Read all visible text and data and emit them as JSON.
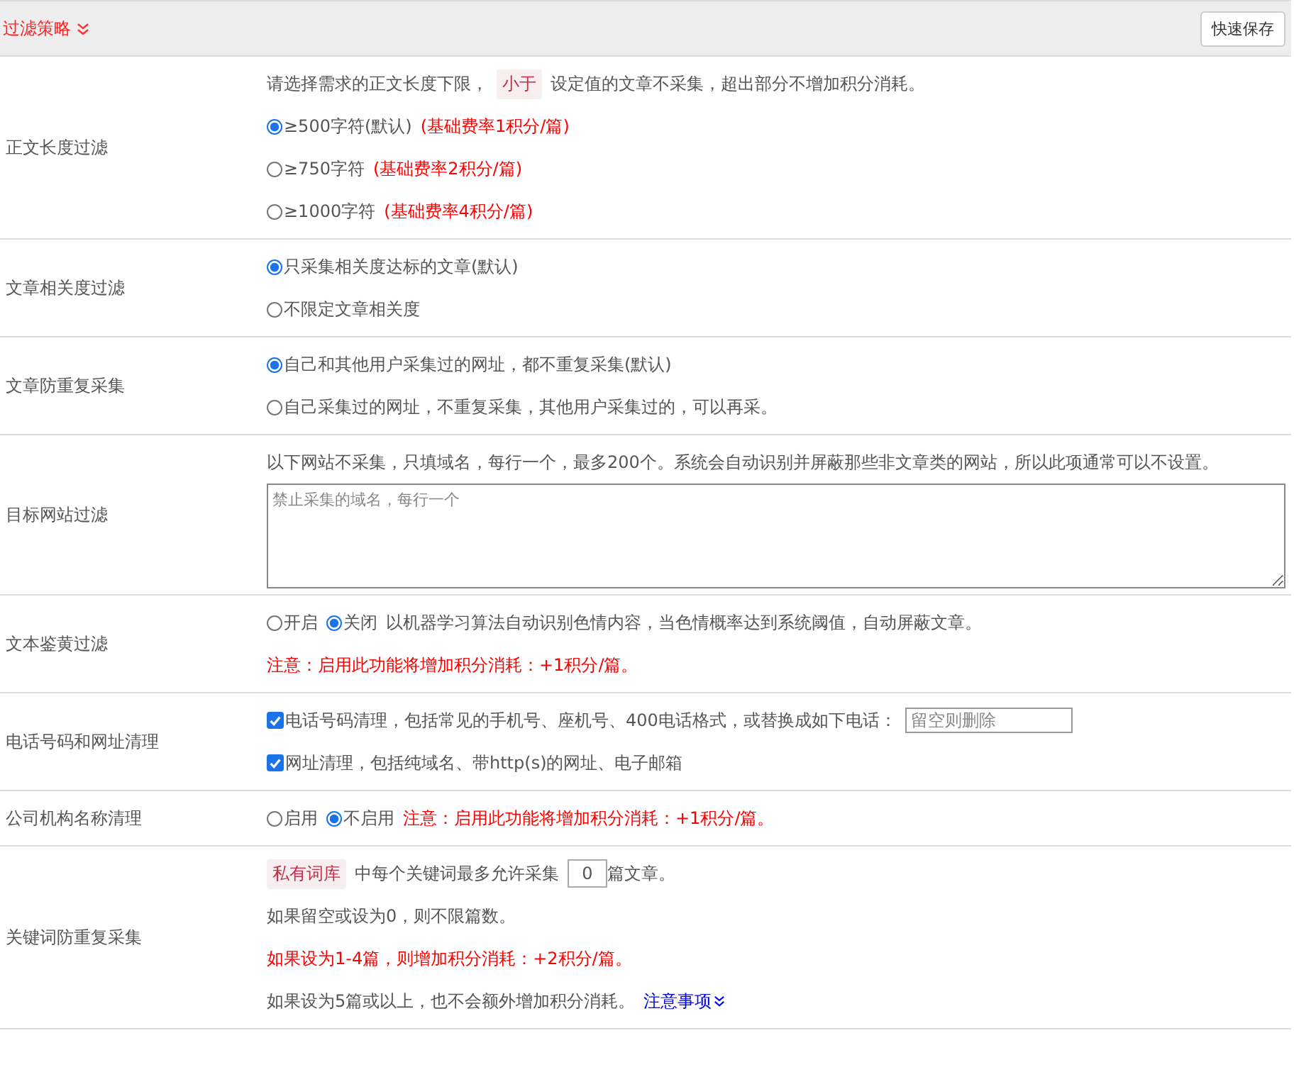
{
  "header": {
    "title": "过滤策略",
    "save_button": "快速保存"
  },
  "rows": [
    {
      "label": "正文长度过滤",
      "lines": [
        {
          "items": [
            {
              "kind": "text",
              "text": "请选择需求的正文长度下限，"
            },
            {
              "kind": "tag",
              "text": "小于"
            },
            {
              "kind": "text",
              "text": "设定值的文章不采集，超出部分不增加积分消耗。"
            }
          ]
        },
        {
          "items": [
            {
              "kind": "radio",
              "label": "≥500字符(默认)",
              "selected": true
            },
            {
              "kind": "red",
              "text": "(基础费率1积分/篇)"
            }
          ]
        },
        {
          "items": [
            {
              "kind": "radio",
              "label": "≥750字符",
              "selected": false
            },
            {
              "kind": "red",
              "text": "(基础费率2积分/篇)"
            }
          ]
        },
        {
          "items": [
            {
              "kind": "radio",
              "label": "≥1000字符",
              "selected": false
            },
            {
              "kind": "red",
              "text": "(基础费率4积分/篇)"
            }
          ]
        }
      ]
    },
    {
      "label": "文章相关度过滤",
      "lines": [
        {
          "items": [
            {
              "kind": "radio",
              "label": "只采集相关度达标的文章(默认)",
              "selected": true
            }
          ]
        },
        {
          "items": [
            {
              "kind": "radio",
              "label": "不限定文章相关度",
              "selected": false
            }
          ]
        }
      ]
    },
    {
      "label": "文章防重复采集",
      "lines": [
        {
          "items": [
            {
              "kind": "radio",
              "label": "自己和其他用户采集过的网址，都不重复采集(默认)",
              "selected": true
            }
          ]
        },
        {
          "items": [
            {
              "kind": "radio",
              "label": "自己采集过的网址，不重复采集，其他用户采集过的，可以再采。",
              "selected": false
            }
          ]
        }
      ]
    },
    {
      "label": "目标网站过滤",
      "lines": [
        {
          "items": [
            {
              "kind": "text",
              "text": "以下网站不采集，只填域名，每行一个，最多200个。系统会自动识别并屏蔽那些非文章类的网站，所以此项通常可以不设置。"
            }
          ]
        },
        {
          "items": [
            {
              "kind": "textarea",
              "placeholder": "禁止采集的域名，每行一个"
            }
          ]
        }
      ]
    },
    {
      "label": "文本鉴黄过滤",
      "lines": [
        {
          "items": [
            {
              "kind": "radio",
              "label": "开启",
              "selected": false
            },
            {
              "kind": "radio",
              "label": "关闭",
              "selected": true
            },
            {
              "kind": "text",
              "text": "以机器学习算法自动识别色情内容，当色情概率达到系统阈值，自动屏蔽文章。"
            }
          ]
        },
        {
          "items": [
            {
              "kind": "red",
              "text": "注意：启用此功能将增加积分消耗：+1积分/篇。"
            }
          ]
        }
      ]
    },
    {
      "label": "电话号码和网址清理",
      "lines": [
        {
          "items": [
            {
              "kind": "checkbox",
              "label": "电话号码清理，包括常见的手机号、座机号、400电话格式，或替换成如下电话：",
              "checked": true
            },
            {
              "kind": "field",
              "placeholder": "留空则删除"
            }
          ]
        },
        {
          "items": [
            {
              "kind": "checkbox",
              "label": "网址清理，包括纯域名、带http(s)的网址、电子邮箱",
              "checked": true
            }
          ]
        }
      ]
    },
    {
      "label": "公司机构名称清理",
      "lines": [
        {
          "items": [
            {
              "kind": "radio",
              "label": "启用",
              "selected": false
            },
            {
              "kind": "radio",
              "label": "不启用",
              "selected": true
            },
            {
              "kind": "red",
              "text": "注意：启用此功能将增加积分消耗：+1积分/篇。"
            }
          ]
        }
      ]
    },
    {
      "label": "关键词防重复采集",
      "lines": [
        {
          "items": [
            {
              "kind": "tag",
              "text": "私有词库"
            },
            {
              "kind": "text",
              "text": "中每个关键词最多允许采集"
            },
            {
              "kind": "number",
              "value": "0"
            },
            {
              "kind": "text",
              "text": "篇文章。"
            }
          ]
        },
        {
          "items": [
            {
              "kind": "text",
              "text": "如果留空或设为0，则不限篇数。"
            }
          ]
        },
        {
          "items": [
            {
              "kind": "red",
              "text": "如果设为1-4篇，则增加积分消耗：+2积分/篇。"
            }
          ]
        },
        {
          "items": [
            {
              "kind": "text",
              "text": "如果设为5篇或以上，也不会额外增加积分消耗。"
            },
            {
              "kind": "link",
              "text": "注意事项"
            }
          ]
        }
      ]
    }
  ]
}
